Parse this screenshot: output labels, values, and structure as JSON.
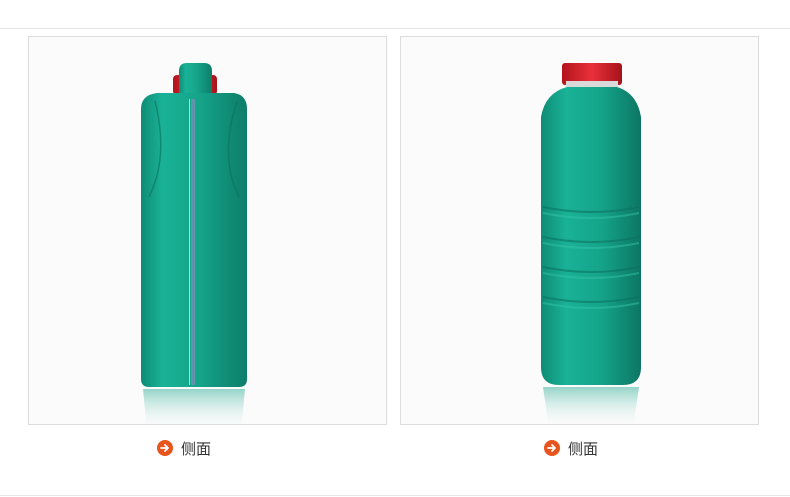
{
  "colors": {
    "bottle_body": "#15a48a",
    "bottle_dark": "#0d7d69",
    "cap": "#d8202a",
    "caption_icon": "#e8541e"
  },
  "panels": [
    {
      "view": "side",
      "caption": "侧面",
      "icon": "arrow-right-circle-icon"
    },
    {
      "view": "front",
      "caption": "侧面",
      "icon": "arrow-right-circle-icon"
    }
  ]
}
